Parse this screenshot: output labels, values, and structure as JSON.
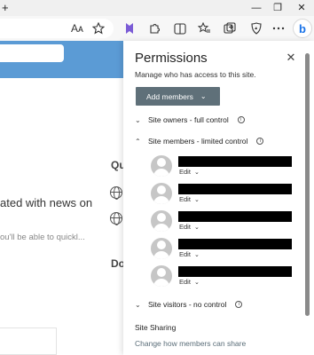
{
  "browser": {
    "new_tab_glyph": "+",
    "window_controls": {
      "minimize": "—",
      "restore": "❐",
      "close": "✕"
    },
    "toolbar_icons": [
      "read-aloud-icon",
      "favorite-star-icon",
      "extension-icon",
      "extensions-puzzle-icon",
      "split-screen-icon",
      "favorites-icon",
      "collections-icon",
      "browser-essentials-icon",
      "more-icon"
    ],
    "read_aloud_label": "Aᴀ",
    "bing_label": "b"
  },
  "page": {
    "heading_fragment": "ated with news on",
    "subtext_fragment": "ou'll be able to quickl...",
    "q_fragment": "Qu",
    "do_fragment": "Do"
  },
  "panel": {
    "title": "Permissions",
    "close_glyph": "✕",
    "subtitle": "Manage who has access to this site.",
    "add_members_label": "Add members",
    "sections": {
      "owners": "Site owners - full control",
      "members": "Site members - limited control",
      "visitors": "Site visitors - no control"
    },
    "members": [
      {
        "role": "Edit"
      },
      {
        "role": "Edit"
      },
      {
        "role": "Edit"
      },
      {
        "role": "Edit"
      },
      {
        "role": "Edit"
      }
    ],
    "site_sharing_title": "Site Sharing",
    "site_sharing_link": "Change how members can share"
  },
  "colors": {
    "accent_button": "#5f7079",
    "banner": "#5b9bd5",
    "edge_purple": "#7b5cd6"
  }
}
